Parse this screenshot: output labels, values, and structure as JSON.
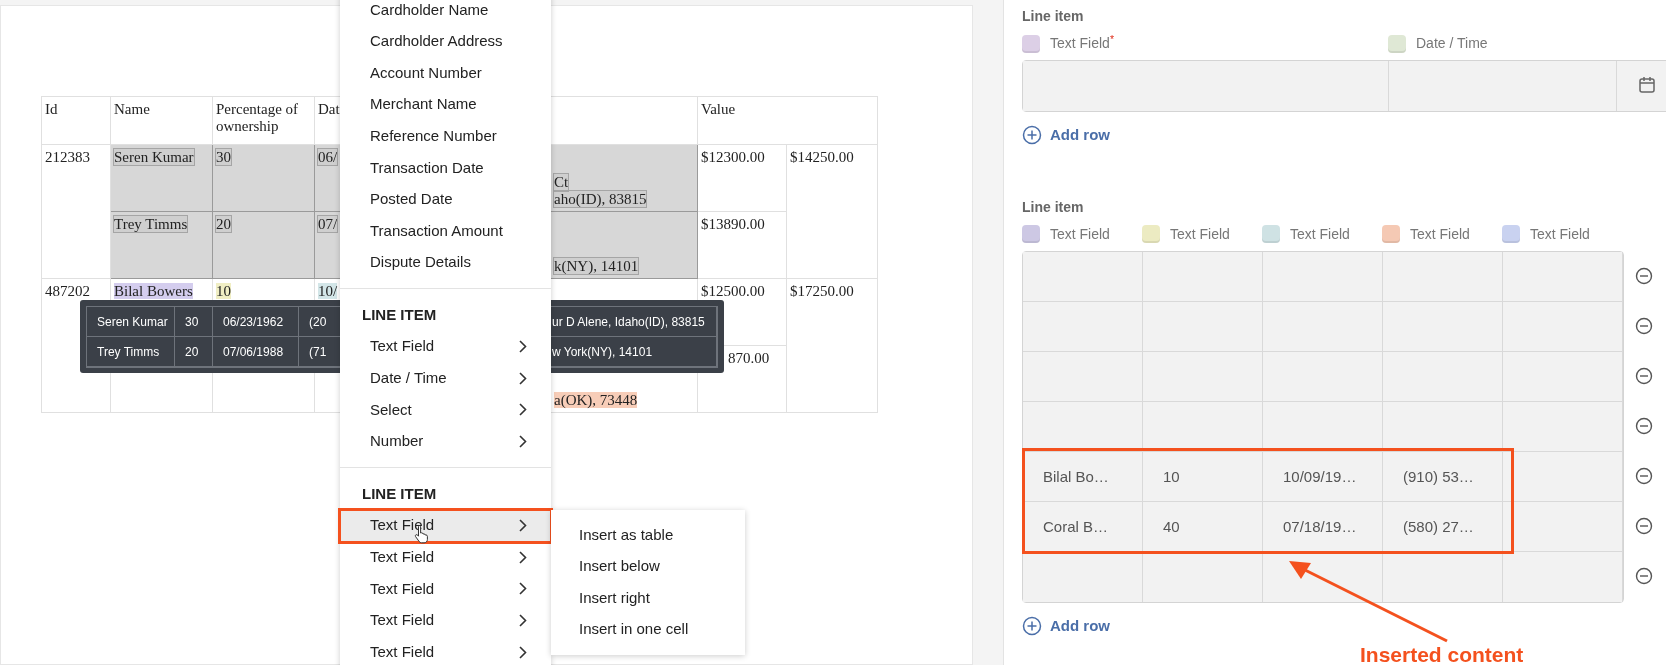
{
  "document": {
    "header": {
      "id": "Id",
      "name": "Name",
      "percentage": "Percentage of ownership",
      "date": "Dat",
      "value": "Value"
    },
    "records": [
      {
        "id": "212383",
        "value_total": "$14250.00",
        "entries": [
          {
            "selected": true,
            "name": {
              "text": "Seren Kumar"
            },
            "percentage": {
              "text": "30"
            },
            "date": {
              "text": "06/"
            },
            "address": {
              "lines": [
                "Ct",
                "aho(ID), 83815"
              ]
            },
            "value": {
              "text": "$12300.00"
            }
          },
          {
            "selected": true,
            "name": {
              "text": "Trey Timms"
            },
            "percentage": {
              "text": "20"
            },
            "date": {
              "text": "07/"
            },
            "address": {
              "lines": [
                "k(NY), 14101"
              ]
            },
            "value": {
              "text": "$13890.00"
            }
          }
        ]
      },
      {
        "id": "487202",
        "value_total": "$17250.00",
        "entries": [
          {
            "selected": false,
            "name": {
              "text": "Bilal Bowers",
              "color": "#d4cdee"
            },
            "percentage": {
              "text": "10",
              "color": "#f0eec4"
            },
            "date": {
              "text": "10/",
              "color": "#d3e6e8"
            },
            "value": {
              "text": "$12500.00"
            }
          },
          {
            "selected": false,
            "address": {
              "lines": [
                "a(OK), 73448"
              ],
              "color": "#f7cdb8"
            },
            "value": {
              "text": "870.00"
            }
          }
        ]
      }
    ]
  },
  "tooltip": {
    "rows": [
      {
        "cells": [
          "Seren Kumar",
          "30",
          "06/23/1962",
          "(20"
        ],
        "tail": "ur D Alene, Idaho(ID), 83815"
      },
      {
        "cells": [
          "Trey Timms",
          "20",
          "07/06/1988",
          "(71"
        ],
        "tail": "w York(NY), 14101"
      }
    ]
  },
  "menu": {
    "sections": [
      {
        "items": [
          {
            "label": "Cardholder Name",
            "submenu": false,
            "selected": false,
            "annotated": false
          },
          {
            "label": "Cardholder Address",
            "submenu": false,
            "selected": false,
            "annotated": false
          },
          {
            "label": "Account Number",
            "submenu": false,
            "selected": false,
            "annotated": false
          },
          {
            "label": "Merchant Name",
            "submenu": false,
            "selected": false,
            "annotated": false
          },
          {
            "label": "Reference Number",
            "submenu": false,
            "selected": false,
            "annotated": false
          },
          {
            "label": "Transaction Date",
            "submenu": false,
            "selected": false,
            "annotated": false
          },
          {
            "label": "Posted Date",
            "submenu": false,
            "selected": false,
            "annotated": false
          },
          {
            "label": "Transaction Amount",
            "submenu": false,
            "selected": false,
            "annotated": false
          },
          {
            "label": "Dispute Details",
            "submenu": false,
            "selected": false,
            "annotated": false
          }
        ]
      },
      {
        "heading": "LINE ITEM",
        "items": [
          {
            "label": "Text Field",
            "submenu": true,
            "selected": false,
            "annotated": false
          },
          {
            "label": "Date / Time",
            "submenu": true,
            "selected": false,
            "annotated": false
          },
          {
            "label": "Select",
            "submenu": true,
            "selected": false,
            "annotated": false
          },
          {
            "label": "Number",
            "submenu": true,
            "selected": false,
            "annotated": false
          }
        ]
      },
      {
        "heading": "LINE ITEM",
        "items": [
          {
            "label": "Text Field",
            "submenu": true,
            "selected": true,
            "annotated": true
          },
          {
            "label": "Text Field",
            "submenu": true,
            "selected": false,
            "annotated": false
          },
          {
            "label": "Text Field",
            "submenu": true,
            "selected": false,
            "annotated": false
          },
          {
            "label": "Text Field",
            "submenu": true,
            "selected": false,
            "annotated": false
          },
          {
            "label": "Text Field",
            "submenu": true,
            "selected": false,
            "annotated": false
          }
        ]
      }
    ],
    "submenu": [
      "Insert as table",
      "Insert below",
      "Insert right",
      "Insert in one cell"
    ]
  },
  "line_items": [
    {
      "title": "Line item",
      "fields": [
        {
          "label": "Text Field",
          "kind": "text",
          "required_mark": "*",
          "color": "#dccfe6"
        },
        {
          "label": "Date / Time",
          "kind": "date",
          "color": "#dfe8d5"
        }
      ],
      "rows": [
        {
          "highlighted": false
        }
      ],
      "add_row": "Add row"
    },
    {
      "title": "Line item",
      "fields": [
        {
          "label": "Text Field",
          "kind": "text",
          "color": "#cdc8e4"
        },
        {
          "label": "Text Field",
          "kind": "text",
          "color": "#ecebc2"
        },
        {
          "label": "Text Field",
          "kind": "text",
          "color": "#cfe2e4"
        },
        {
          "label": "Text Field",
          "kind": "text",
          "color": "#f5c9b4"
        },
        {
          "label": "Text Field",
          "kind": "text",
          "color": "#c9d2f0"
        }
      ],
      "rows": [
        {
          "removable": true,
          "highlighted": false
        },
        {
          "removable": true,
          "highlighted": false
        },
        {
          "removable": true,
          "highlighted": false
        },
        {
          "removable": true,
          "highlighted": false
        },
        {
          "removable": true,
          "highlighted": true,
          "cells": [
            "Bilal Bo…",
            "10",
            "10/09/19…",
            "(910) 53…"
          ]
        },
        {
          "removable": true,
          "highlighted": true,
          "cells": [
            "Coral B…",
            "40",
            "07/18/19…",
            "(580) 27…"
          ]
        },
        {
          "removable": true,
          "highlighted": false
        }
      ],
      "add_row": "Add row",
      "callout": "Inserted content"
    }
  ]
}
